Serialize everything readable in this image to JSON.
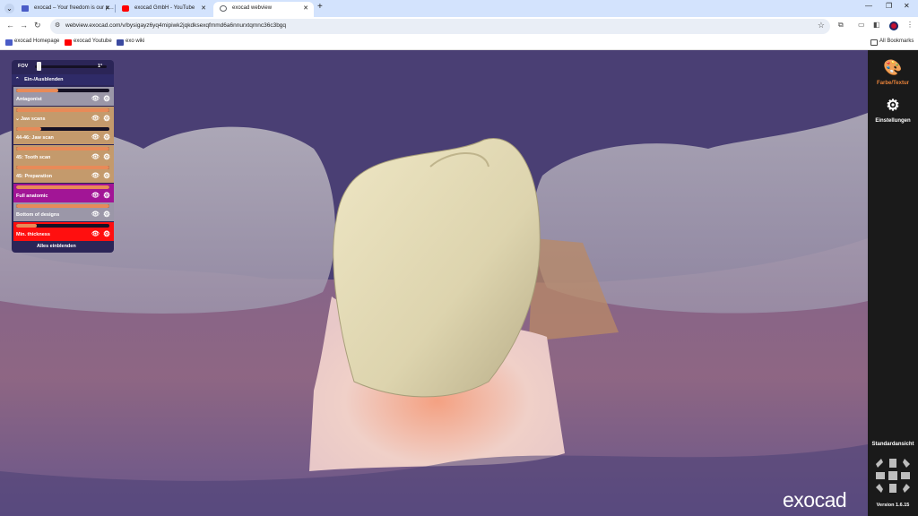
{
  "browser": {
    "tabs": [
      {
        "title": "exocad – Your freedom is our p…",
        "icon": "exocad-favicon",
        "active": false
      },
      {
        "title": "exocad GmbH - YouTube",
        "icon": "youtube-favicon",
        "active": false
      },
      {
        "title": "exocad webview",
        "icon": "globe-favicon",
        "active": true
      }
    ],
    "url": "webview.exocad.com/v/bysigayz6yq4mipiwk2jqkdksexqfmmd6a6nnurxtqmnc36c3bgq",
    "bookmarks": [
      {
        "label": "exocad Homepage",
        "icon": "exocad-favicon"
      },
      {
        "label": "exocad Youtube",
        "icon": "youtube-favicon"
      },
      {
        "label": "exo wiki",
        "icon": "wiki-favicon"
      }
    ],
    "all_bookmarks": "All Bookmarks"
  },
  "layers_panel": {
    "fov_label": "FOV",
    "fov_value": "1°",
    "fov_level": 0.05,
    "section_title": "Ein-/Ausblenden",
    "layers": [
      {
        "name": "Antagonist",
        "opacity": 0.45,
        "bg": "#9b97a8"
      },
      {
        "name": "Jaw scans",
        "opacity": 1.0,
        "bg": "#c49a6c",
        "has_chevron": true
      },
      {
        "name": "44-46: Jaw scan",
        "opacity": 0.27,
        "bg": "#c49a6c"
      },
      {
        "name": "45: Tooth scan",
        "opacity": 1.0,
        "bg": "#c49a6c"
      },
      {
        "name": "45: Preparation",
        "opacity": 1.0,
        "bg": "#c49a6c"
      },
      {
        "name": "Full anatomic",
        "opacity": 1.0,
        "bg": "#a21596"
      },
      {
        "name": "Bottom of designs",
        "opacity": 1.0,
        "bg": "#9b97a8"
      },
      {
        "name": "Min. thickness",
        "opacity": 0.22,
        "bg": "#ff0f0f"
      }
    ],
    "show_all_label": "Alles einblenden"
  },
  "side_panel": {
    "color_texture_label": "Farbe/Textur",
    "settings_label": "Einstellungen",
    "standard_view_label": "Standardansicht",
    "version": "Version 1.6.15"
  },
  "watermark": "exocad",
  "colors": {
    "accent": "#e8833a",
    "viewport_bg": "#4a3f74",
    "panel_bg": "#2b2557",
    "crown": "#ddd4ae"
  }
}
